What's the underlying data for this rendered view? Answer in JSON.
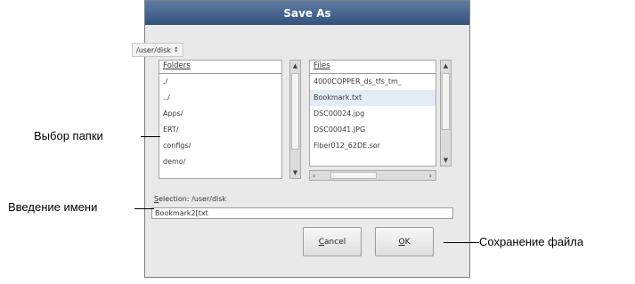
{
  "dialog": {
    "title": "Save As",
    "path_select": {
      "value": "/user/disk",
      "arrows": "↕"
    },
    "folders": {
      "header": "Folders",
      "items": [
        "./",
        "../",
        "Apps/",
        "ERT/",
        "configs/",
        "demo/"
      ]
    },
    "files": {
      "header": "Files",
      "items": [
        "4000COPPER_ds_tfs_tm_",
        "Bookmark.txt",
        "DSC00024.jpg",
        "DSC00041.JPG",
        "Fiber012_62DE.sor"
      ],
      "selected_index": 1
    },
    "hscroll": {
      "left": "‹",
      "right": "›"
    },
    "selection": {
      "label_underlined": "S",
      "label_rest": "election: /user/disk"
    },
    "name_value": "Bookmark2[txt",
    "cancel_underlined": "C",
    "cancel_rest": "ancel",
    "ok_underlined": "O",
    "ok_rest": "K"
  },
  "annotations": {
    "folder_select": "Выбор папки",
    "name_entry": "Введение имени",
    "save_file": "Сохранение файла"
  }
}
